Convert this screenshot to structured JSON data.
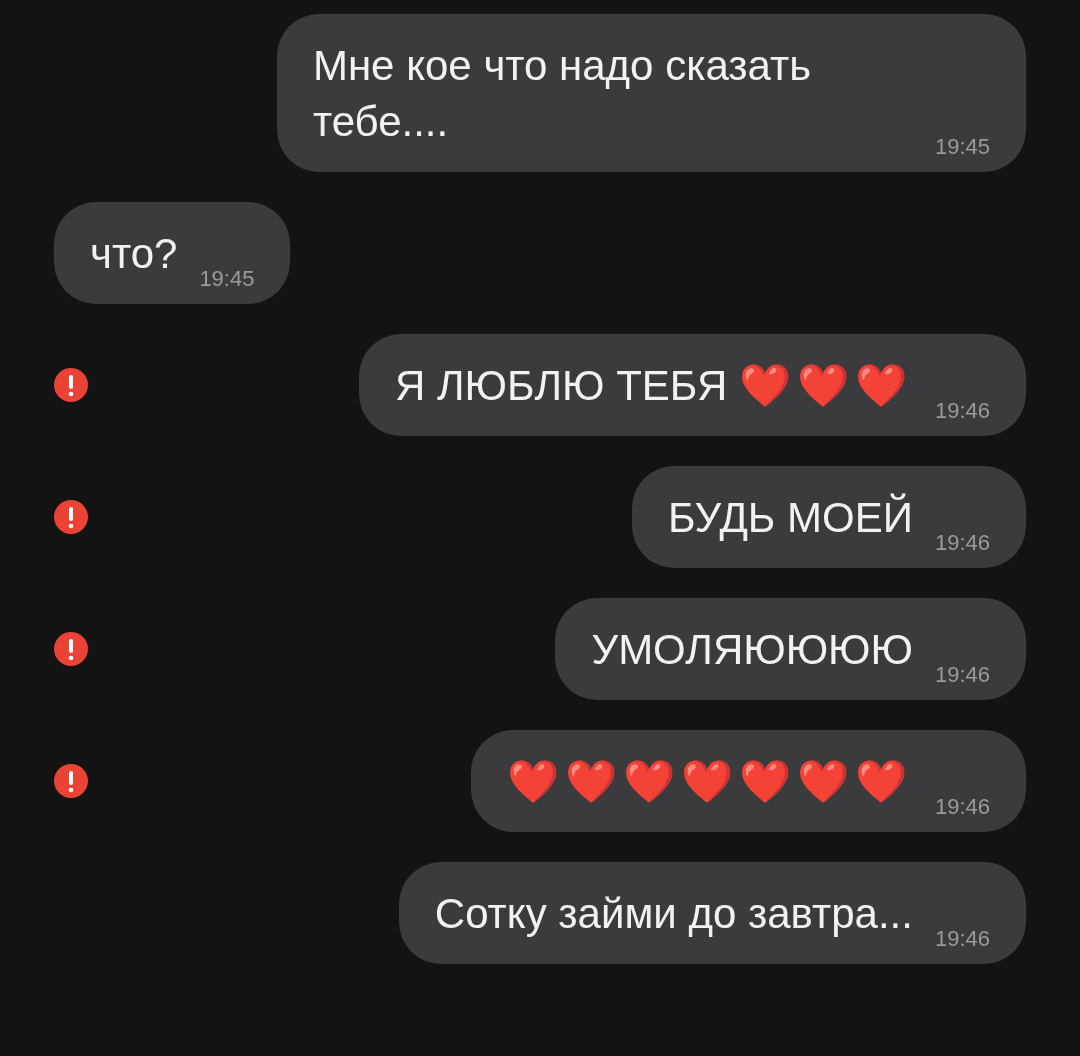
{
  "messages": [
    {
      "outgoing": true,
      "failed": false,
      "text": "Мне кое что надо сказать тебе....",
      "time": "19:45"
    },
    {
      "outgoing": false,
      "failed": false,
      "text": "что?",
      "time": "19:45"
    },
    {
      "outgoing": true,
      "failed": true,
      "text": "Я ЛЮБЛЮ ТЕБЯ",
      "emoji": "❤️❤️❤️",
      "time": "19:46"
    },
    {
      "outgoing": true,
      "failed": true,
      "text": "БУДЬ МОЕЙ",
      "time": "19:46"
    },
    {
      "outgoing": true,
      "failed": true,
      "text": "УМОЛЯЮЮЮЮ",
      "time": "19:46"
    },
    {
      "outgoing": true,
      "failed": true,
      "emoji": "❤️❤️❤️❤️❤️❤️❤️",
      "time": "19:46"
    },
    {
      "outgoing": true,
      "failed": false,
      "text": "Сотку займи до завтра...",
      "time": "19:46"
    }
  ]
}
